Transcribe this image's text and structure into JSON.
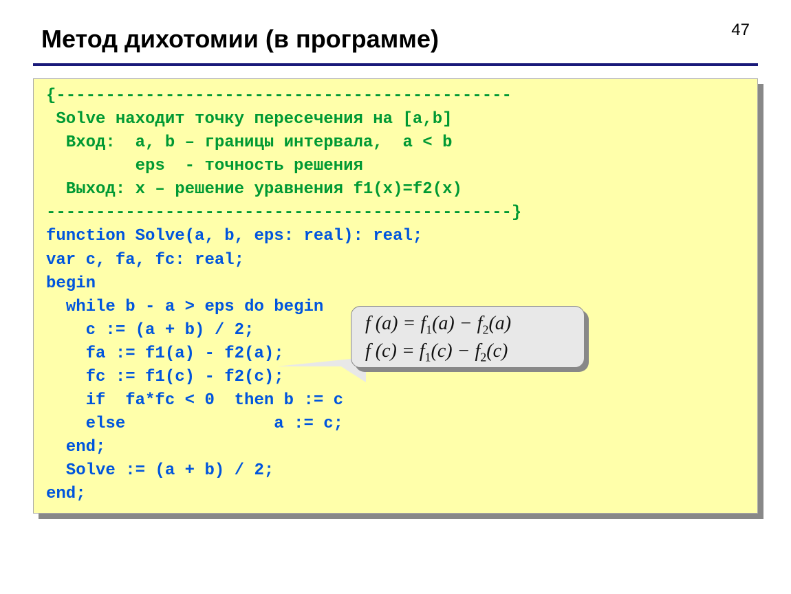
{
  "page_number": "47",
  "title": "Метод дихотомии (в программе)",
  "code": {
    "c1": "{----------------------------------------------",
    "c2": " Solve находит точку пересечения на [a,b]",
    "c3": "  Вход:  a, b – границы интервала,  a < b",
    "c4": "         eps  - точность решения",
    "c5": "  Выход: x – решение уравнения f1(x)=f2(x)",
    "c6": "-----------------------------------------------}",
    "l1a": "function",
    "l1b": " Solve(a, b, eps: real): real;",
    "l2a": "var",
    "l2b": " c, fa, fc: real;",
    "l3": "begin",
    "l4a": "  while",
    "l4b": " b - a > eps ",
    "l4c": "do begin",
    "l5": "    c := (a + b) / 2;",
    "l6": "    fa := f1(a) - f2(a);",
    "l7": "    fc := f1(c) - f2(c);",
    "l8a": "    if",
    "l8b": "  fa*fc < 0  ",
    "l8c": "then",
    "l8d": " b := c",
    "l9a": "    else",
    "l9b": "               a := c;",
    "l10": "  end",
    "l10b": ";",
    "l11": "  Solve := (a + b) / 2;",
    "l12": "end",
    "l12b": ";"
  },
  "callout": {
    "line1_pre": "f (a) = f",
    "line1_sub1": "1",
    "line1_mid": "(a) − f",
    "line1_sub2": "2",
    "line1_end": "(a)",
    "line2_pre": "f (c) = f",
    "line2_sub1": "1",
    "line2_mid": "(c) − f",
    "line2_sub2": "2",
    "line2_end": "(c)"
  }
}
